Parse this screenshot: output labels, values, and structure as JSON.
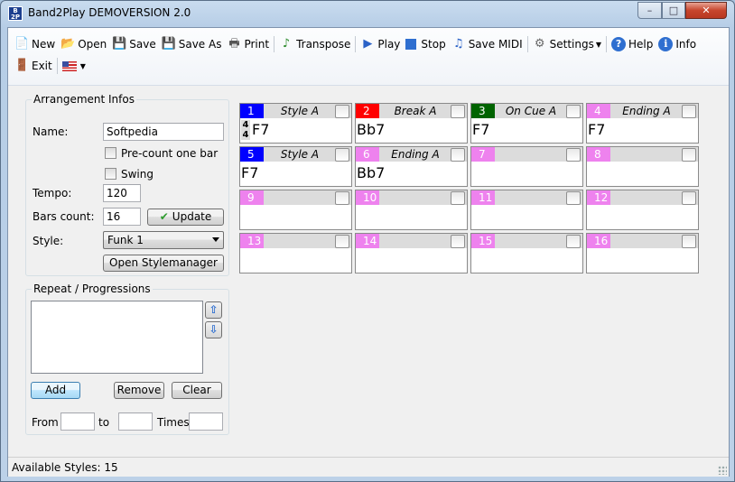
{
  "window": {
    "title": "Band2Play DEMOVERSION 2.0",
    "icon_text": "B 2P",
    "controls": {
      "minimize": "–",
      "maximize": "□",
      "close": "✕"
    }
  },
  "toolbar": {
    "new": "New",
    "open": "Open",
    "save": "Save",
    "save_as": "Save As",
    "print": "Print",
    "transpose": "Transpose",
    "play": "Play",
    "stop": "Stop",
    "save_midi": "Save MIDI",
    "settings": "Settings",
    "help": "Help",
    "info": "Info",
    "exit": "Exit"
  },
  "icons": {
    "new": "📄",
    "open": "📂",
    "save": "💾",
    "print": "🖶",
    "transpose": "♪",
    "play": "▶",
    "midi": "♫",
    "gear": "⚙",
    "help": "?",
    "info": "i",
    "exit": "🚪"
  },
  "arrangement": {
    "group_title": "Arrangement Infos",
    "name_label": "Name:",
    "name_value": "Softpedia",
    "precount_label": "Pre-count one bar",
    "swing_label": "Swing",
    "tempo_label": "Tempo:",
    "tempo_value": "120",
    "bars_label": "Bars count:",
    "bars_value": "16",
    "update_label": "Update",
    "style_label": "Style:",
    "style_value": "Funk 1",
    "open_stylemanager_label": "Open Stylemanager"
  },
  "repeat": {
    "group_title": "Repeat / Progressions",
    "add_label": "Add",
    "remove_label": "Remove",
    "clear_label": "Clear",
    "from_label": "From",
    "to_label": "to",
    "times_label": "Times:",
    "up_glyph": "⇧",
    "down_glyph": "⇩"
  },
  "bars": [
    {
      "num": "1",
      "style": "Style A",
      "chord": "F7",
      "color": "#0000ff",
      "text_color": "#ffffff",
      "timesig_top": "4",
      "timesig_bottom": "4"
    },
    {
      "num": "2",
      "style": "Break A",
      "chord": "Bb7",
      "color": "#ff0000",
      "text_color": "#ffffff"
    },
    {
      "num": "3",
      "style": "On Cue A",
      "chord": "F7",
      "color": "#006400",
      "text_color": "#ffffff"
    },
    {
      "num": "4",
      "style": "Ending A",
      "chord": "F7",
      "color": "#ee82ee",
      "text_color": "#ffffff"
    },
    {
      "num": "5",
      "style": "Style A",
      "chord": "F7",
      "color": "#0000ff",
      "text_color": "#ffffff"
    },
    {
      "num": "6",
      "style": "Ending A",
      "chord": "Bb7",
      "color": "#ee82ee",
      "text_color": "#ffffff"
    },
    {
      "num": "7",
      "style": "",
      "chord": "",
      "color": "#ee82ee",
      "text_color": "#ffffff"
    },
    {
      "num": "8",
      "style": "",
      "chord": "",
      "color": "#ee82ee",
      "text_color": "#ffffff"
    },
    {
      "num": "9",
      "style": "",
      "chord": "",
      "color": "#ee82ee",
      "text_color": "#ffffff"
    },
    {
      "num": "10",
      "style": "",
      "chord": "",
      "color": "#ee82ee",
      "text_color": "#ffffff"
    },
    {
      "num": "11",
      "style": "",
      "chord": "",
      "color": "#ee82ee",
      "text_color": "#ffffff"
    },
    {
      "num": "12",
      "style": "",
      "chord": "",
      "color": "#ee82ee",
      "text_color": "#ffffff"
    },
    {
      "num": "13",
      "style": "",
      "chord": "",
      "color": "#ee82ee",
      "text_color": "#ffffff"
    },
    {
      "num": "14",
      "style": "",
      "chord": "",
      "color": "#ee82ee",
      "text_color": "#ffffff"
    },
    {
      "num": "15",
      "style": "",
      "chord": "",
      "color": "#ee82ee",
      "text_color": "#ffffff"
    },
    {
      "num": "16",
      "style": "",
      "chord": "",
      "color": "#ee82ee",
      "text_color": "#ffffff"
    }
  ],
  "status": {
    "available_styles_label": "Available Styles:",
    "available_styles_value": "15"
  }
}
